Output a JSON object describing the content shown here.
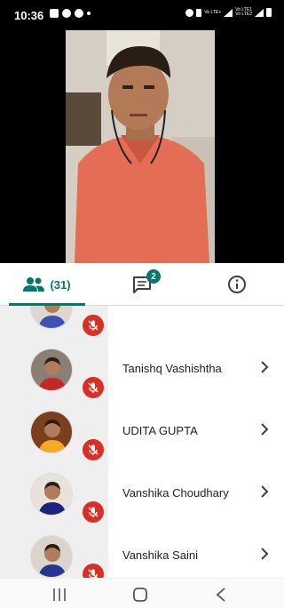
{
  "status_bar": {
    "time": "10:36",
    "network_labels": [
      "Vo LTE+",
      "Vo LTE1",
      "Vo LTE2"
    ]
  },
  "tabs": {
    "people_count": "(31)",
    "chat_badge": "2",
    "active": "people"
  },
  "participants": [
    {
      "name": "",
      "muted": true,
      "avatar_shirt": "#3f51b5",
      "avatar_bg": "#ddd7cf"
    },
    {
      "name": "Tanishq Vashishtha",
      "muted": true,
      "avatar_shirt": "#c62828",
      "avatar_bg": "#8a7f72"
    },
    {
      "name": "UDITA GUPTA",
      "muted": true,
      "avatar_shirt": "#f9a825",
      "avatar_bg": "#7b3f1e"
    },
    {
      "name": "Vanshika Choudhary",
      "muted": true,
      "avatar_shirt": "#1a237e",
      "avatar_bg": "#e8e3da"
    },
    {
      "name": "Vanshika Saini",
      "muted": true,
      "avatar_shirt": "#283593",
      "avatar_bg": "#d9d4cc"
    }
  ],
  "colors": {
    "accent": "#00796b",
    "mute_red": "#d93025",
    "video_shirt": "#e36d55"
  },
  "icons": {
    "people": "people-icon",
    "chat": "chat-icon",
    "info": "info-icon",
    "muted": "mic-off-icon",
    "chevron": "chevron-right-icon"
  }
}
